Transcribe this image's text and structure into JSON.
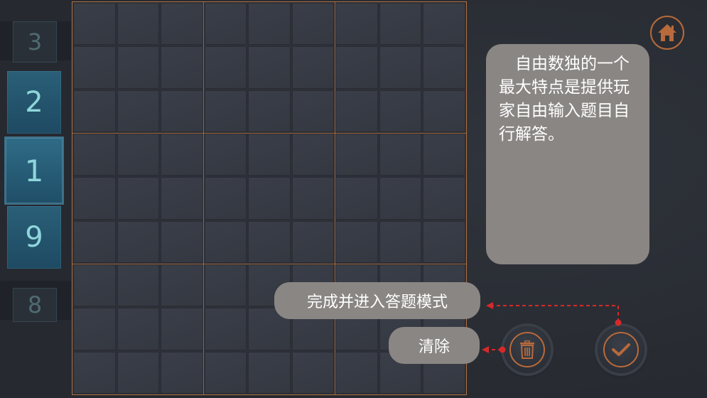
{
  "picker": {
    "numbers": [
      {
        "label": "3",
        "state": "faded"
      },
      {
        "label": "2",
        "state": "normal"
      },
      {
        "label": "1",
        "state": "selected"
      },
      {
        "label": "9",
        "state": "normal"
      },
      {
        "label": "8",
        "state": "faded"
      }
    ]
  },
  "board": {
    "rows": 9,
    "cols": 9
  },
  "tip": {
    "text": "自由数独的一个最大特点是提供玩家自由输入题目自行解答。"
  },
  "hints": {
    "finish_label": "完成并进入答题模式",
    "clear_label": "清除"
  },
  "icons": {
    "home": "home-icon",
    "trash": "trash-icon",
    "check": "check-icon"
  },
  "colors": {
    "accent": "#b86a3a",
    "pointer": "#d42a2a",
    "tile": "#2a5f78",
    "digit": "#8fd6dc"
  }
}
